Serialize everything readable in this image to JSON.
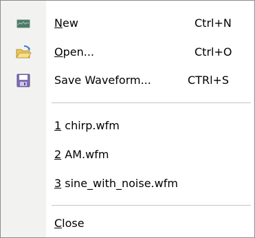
{
  "menu": {
    "items": [
      {
        "icon": "waveform-icon",
        "mnemonic": "N",
        "label_rest": "ew",
        "shortcut": "Ctrl+N"
      },
      {
        "icon": "open-folder-icon",
        "mnemonic": "O",
        "label_rest": "pen...",
        "shortcut": "Ctrl+O"
      },
      {
        "icon": "save-floppy-icon",
        "label": "Save Waveform...",
        "shortcut": "CTRl+S"
      }
    ],
    "recent_files": [
      {
        "mnemonic": "1",
        "label_rest": " chirp.wfm"
      },
      {
        "mnemonic": "2",
        "label_rest": " AM.wfm"
      },
      {
        "mnemonic": "3",
        "label_rest": " sine_with_noise.wfm"
      }
    ],
    "close": {
      "mnemonic": "C",
      "label_rest": "lose"
    }
  },
  "colors": {
    "gutter": "#f2f2f0",
    "border": "#8a8a8a",
    "separator": "#c5c5c5"
  }
}
